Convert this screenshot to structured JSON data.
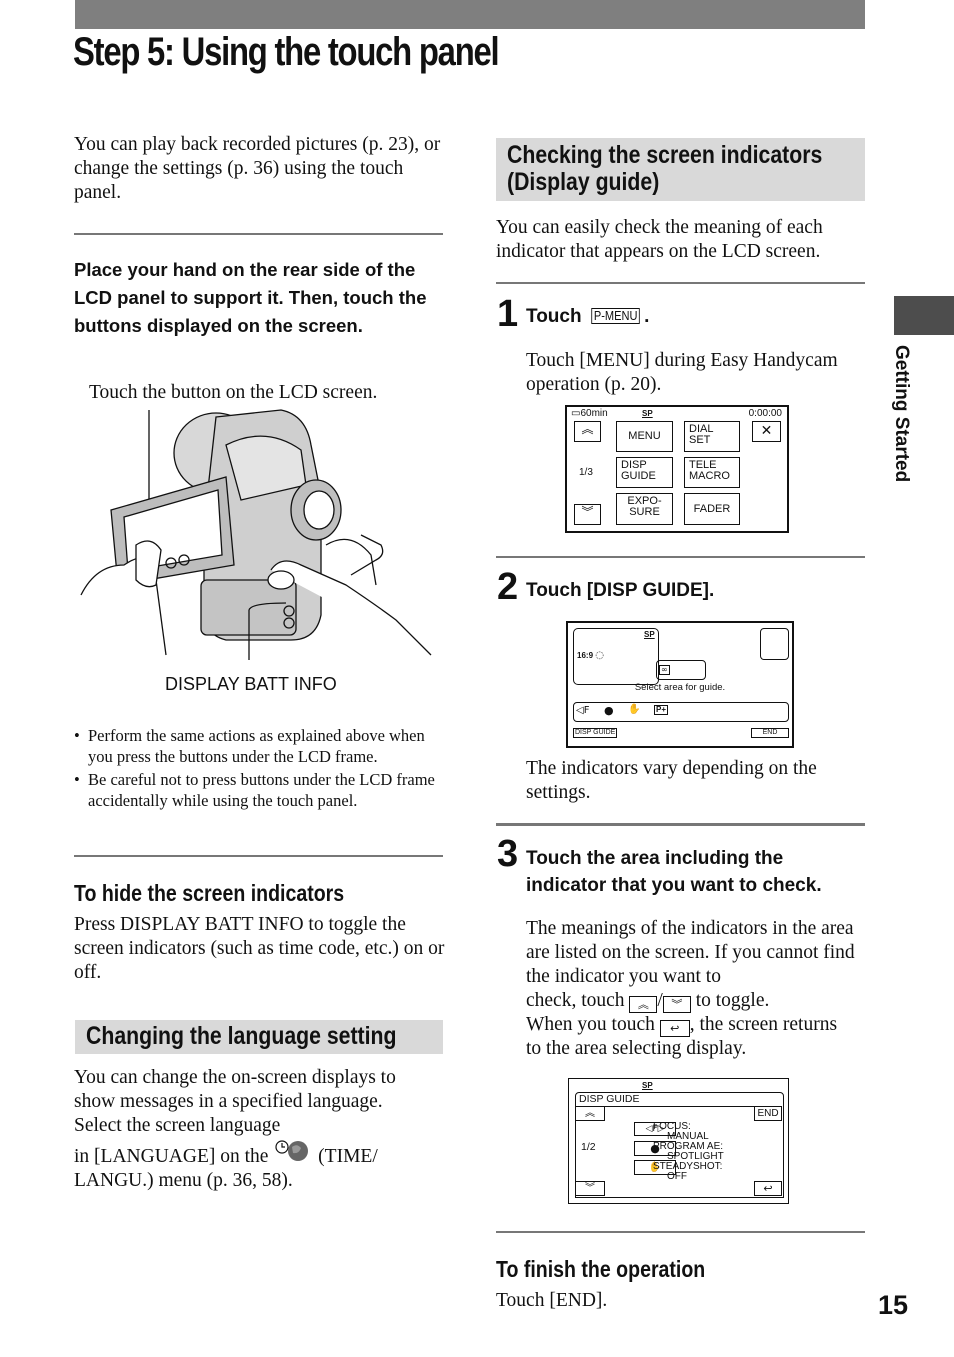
{
  "page": {
    "title": "Step 5: Using the touch panel",
    "side_tab_label": "Getting Started",
    "page_number": "15"
  },
  "left": {
    "intro": "You can play back recorded pictures (p. 23), or change the settings (p. 36) using the touch panel.",
    "instruction": "Place your hand on the rear side of the LCD panel to support it. Then, touch the buttons displayed on the screen.",
    "illustration_caption_top": "Touch the button on the LCD screen.",
    "illustration_label_bottom": "DISPLAY BATT INFO",
    "bullets": [
      "Perform the same actions as explained above when you press the buttons under the LCD frame.",
      "Be careful not to press buttons under the LCD frame accidentally while using the touch panel."
    ],
    "hide_heading": "To hide the screen indicators",
    "hide_text": "Press DISPLAY BATT INFO to toggle the screen indicators (such as time code, etc.) on or off.",
    "language_heading": "Changing the language setting",
    "language_text_1": "You can change the on-screen displays to show messages in a specified language. Select the screen language",
    "language_text_2a": "in [LANGUAGE] on the",
    "language_text_2b": "(TIME/",
    "language_text_3": "LANGU.) menu (p. 36, 58)."
  },
  "right": {
    "section_heading_1": "Checking the screen indicators",
    "section_heading_2": "(Display guide)",
    "section_intro": "You can easily check the meaning of each indicator that appears on the LCD screen.",
    "steps": [
      {
        "number": "1",
        "title_prefix": "Touch",
        "title_key": "P-MENU",
        "title_suffix": ".",
        "body": "Touch [MENU] during Easy Handycam operation (p. 20)."
      },
      {
        "number": "2",
        "title": "Touch [DISP GUIDE].",
        "body": "The indicators vary depending on the settings."
      },
      {
        "number": "3",
        "title": "Touch the area including the indicator that you want to check.",
        "body_1": "The meanings of the indicators in the area are listed on the screen. If you cannot find the indicator you want to",
        "body_2a": "check, touch",
        "body_2b": "/",
        "body_2c": "to toggle.",
        "body_3a": "When you touch",
        "body_3b": ", the screen returns",
        "body_4": "to the area selecting display."
      }
    ],
    "finish_heading": "To finish the operation",
    "finish_text": "Touch [END]."
  },
  "screen_menu": {
    "battery": "60min",
    "mode": "SP",
    "timecode": "0:00:00",
    "page": "1/3",
    "buttons": [
      "MENU",
      "DIAL SET",
      "DISP GUIDE",
      "TELE MACRO",
      "EXPO- SURE",
      "FADER"
    ],
    "up_icon": "double-chevron-up",
    "down_icon": "double-chevron-down",
    "close_icon": "x"
  },
  "screen_guide_select": {
    "mode": "SP",
    "wide": "16:9",
    "prompt": "Select area for guide.",
    "disp_guide_label": "DISP GUIDE",
    "end_label": "END"
  },
  "screen_guide_detail": {
    "mode": "SP",
    "header": "DISP GUIDE",
    "end_label": "END",
    "page": "1/2",
    "items": [
      {
        "label": "FOCUS:",
        "value": "MANUAL"
      },
      {
        "label": "PROGRAM AE:",
        "value": "SPOTLIGHT"
      },
      {
        "label": "STEADYSHOT:",
        "value": "OFF"
      }
    ]
  }
}
